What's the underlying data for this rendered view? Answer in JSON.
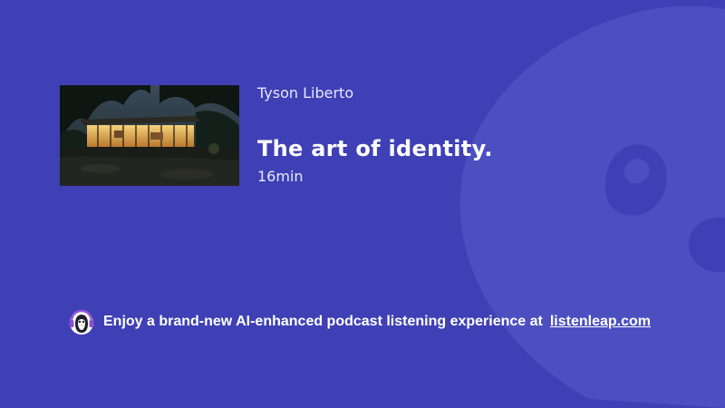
{
  "episode": {
    "author": "Tyson Liberto",
    "title": "The art of identity.",
    "duration": "16min",
    "cover_alt": "Modern glass house at night"
  },
  "footer": {
    "promo_text": "Enjoy a brand-new AI-enhanced podcast listening experience at",
    "link_text": "listenleap.com"
  },
  "colors": {
    "background": "#3f40b5",
    "watermark": "#4b4fc0",
    "text": "#ffffff"
  },
  "icons": {
    "brand_logo": "penguin-headphones-icon",
    "watermark": "penguin-watermark-icon"
  }
}
